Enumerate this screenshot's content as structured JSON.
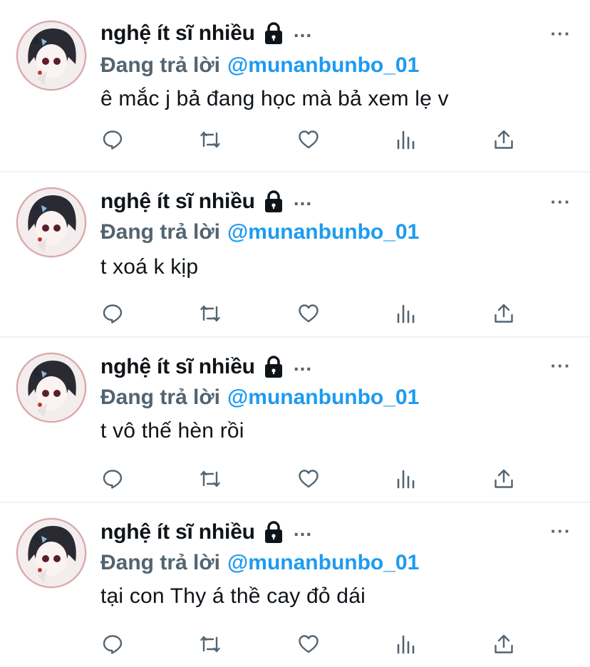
{
  "tweets": [
    {
      "display_name": "nghệ ít sĩ nhiều",
      "reply_prefix": "Đang trả lời",
      "reply_handle": "@munanbunbo_01",
      "text": "ê mắc j bả đang học mà bả xem lẹ v"
    },
    {
      "display_name": "nghệ ít sĩ nhiều",
      "reply_prefix": "Đang trả lời",
      "reply_handle": "@munanbunbo_01",
      "text": "t xoá k kịp"
    },
    {
      "display_name": "nghệ ít sĩ nhiều",
      "reply_prefix": "Đang trả lời",
      "reply_handle": "@munanbunbo_01",
      "text": "t vô thế hèn rồi"
    },
    {
      "display_name": "nghệ ít sĩ nhiều",
      "reply_prefix": "Đang trả lời",
      "reply_handle": "@munanbunbo_01",
      "text": "tại con Thy á thề cay đỏ dái"
    }
  ],
  "ui": {
    "name_overflow": "...",
    "more_menu": "···"
  },
  "icons": {
    "lock": "lock-icon",
    "reply": "reply-icon",
    "retweet": "retweet-icon",
    "like": "like-icon",
    "analytics": "analytics-icon",
    "share": "share-icon"
  },
  "colors": {
    "text": "#0f1419",
    "muted": "#536471",
    "link": "#1d9bf0",
    "divider": "#eff3f4"
  }
}
